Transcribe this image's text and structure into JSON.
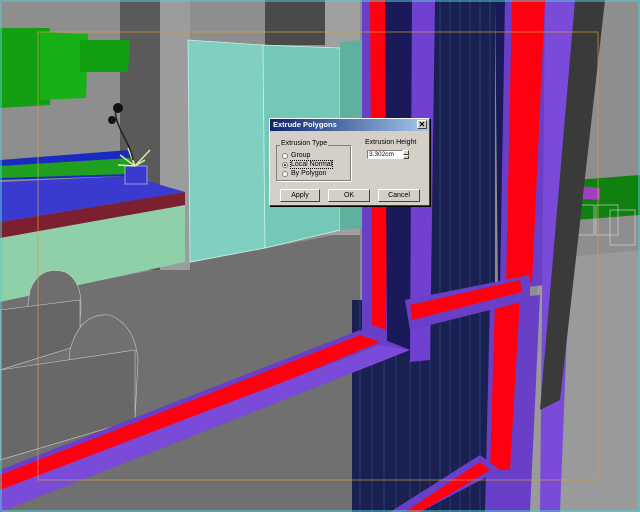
{
  "dialog": {
    "title": "Extrude Polygons",
    "close_glyph": "✕",
    "extrusion_type": {
      "label": "Extrusion Type",
      "options": [
        "Group",
        "Local Normal",
        "By Polygon"
      ],
      "selected": "Local Normal"
    },
    "extrusion_height": {
      "label": "Extrusion Height",
      "value": "3.302cm"
    },
    "buttons": {
      "apply": "Apply",
      "ok": "OK",
      "cancel": "Cancel"
    }
  },
  "viewport": {
    "scene": "3D perspective viewport",
    "colors": {
      "frame_purple": "#6a3fc8",
      "frame_red": "#ff0010",
      "frame_navy": "#1a1a5a",
      "glass_teal": "#7fd0c0",
      "counter_blue": "#3a3ad0",
      "green_panel": "#12a012",
      "wireframe_gray": "#b0b0b0"
    }
  }
}
